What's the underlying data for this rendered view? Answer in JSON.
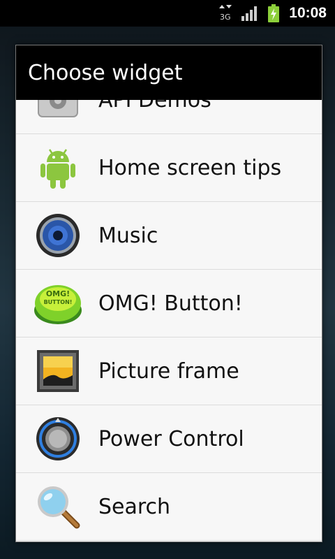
{
  "status_bar": {
    "network_label": "3G",
    "time": "10:08"
  },
  "dialog": {
    "title": "Choose widget",
    "items": [
      {
        "label": "API Demos",
        "icon": "gear-icon"
      },
      {
        "label": "Home screen tips",
        "icon": "android-icon"
      },
      {
        "label": "Music",
        "icon": "speaker-icon"
      },
      {
        "label": "OMG! Button!",
        "icon": "omg-button-icon",
        "icon_text": "OMG! BUTTON!"
      },
      {
        "label": "Picture frame",
        "icon": "picture-frame-icon"
      },
      {
        "label": "Power Control",
        "icon": "power-knob-icon"
      },
      {
        "label": "Search",
        "icon": "magnifier-icon"
      }
    ]
  }
}
